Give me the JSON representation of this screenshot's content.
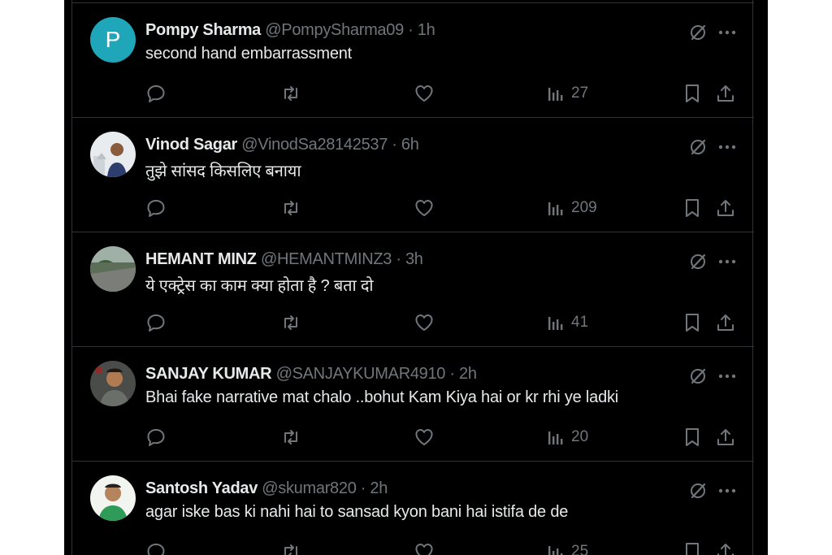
{
  "tweets": [
    {
      "name": "Pompy Sharma",
      "handle": "@PompySharma09",
      "time": "1h",
      "text": "second hand embarrassment",
      "views": "27",
      "avatar": {
        "type": "letter",
        "letter": "P"
      }
    },
    {
      "name": "Vinod Sagar",
      "handle": "@VinodSa28142537",
      "time": "6h",
      "text": "तुझे सांसद किसलिए बनाया",
      "views": "209",
      "avatar": {
        "type": "photo"
      }
    },
    {
      "name": "HEMANT MINZ",
      "handle": "@HEMANTMINZ3",
      "time": "3h",
      "text": "ये एक्ट्रेस का काम क्या होता है ? बता दो",
      "views": "41",
      "avatar": {
        "type": "photo"
      }
    },
    {
      "name": "SANJAY KUMAR",
      "handle": "@SANJAYKUMAR4910",
      "time": "2h",
      "text": "Bhai  fake narrative mat chalo ..bohut Kam Kiya hai or kr rhi ye ladki",
      "views": "20",
      "avatar": {
        "type": "photo"
      }
    },
    {
      "name": "Santosh Yadav",
      "handle": "@skumar820",
      "time": "2h",
      "text": "agar iske bas ki nahi hai to sansad kyon bani hai istifa de de",
      "views": "25",
      "avatar": {
        "type": "photo"
      }
    }
  ],
  "separator": " · ",
  "colors": {
    "background": "#000000",
    "text": "#e7e9ea",
    "muted": "#71767b",
    "border": "#2f3336",
    "avatar_p": "#1fa6b8"
  }
}
